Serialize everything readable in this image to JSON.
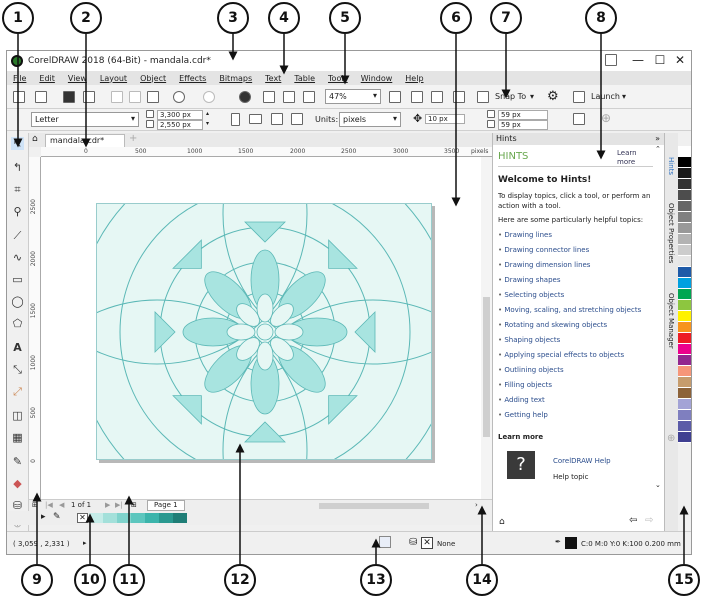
{
  "window": {
    "title": "CorelDRAW 2018 (64-Bit) - mandala.cdr*",
    "controls": [
      "—",
      "☐",
      "✕"
    ]
  },
  "menu": [
    "File",
    "Edit",
    "View",
    "Layout",
    "Object",
    "Effects",
    "Bitmaps",
    "Text",
    "Table",
    "Tools",
    "Window",
    "Help"
  ],
  "standard_toolbar": {
    "zoom": "47%",
    "snap_to": "Snap To",
    "launch": "Launch"
  },
  "property_bar": {
    "page_size": "Letter",
    "width": "3,300 px",
    "height": "2,550 px",
    "units_label": "Units:",
    "units": "pixels",
    "nudge": "10 px",
    "dup_x": "59 px",
    "dup_y": "59 px"
  },
  "document_tab": "mandala.cdr*",
  "rulers": {
    "horizontal": [
      "0",
      "500",
      "1000",
      "1500",
      "2000",
      "2500",
      "3000",
      "3500",
      "pixels"
    ],
    "vertical": [
      "2500",
      "2000",
      "1500",
      "1000",
      "500",
      "0"
    ]
  },
  "page_nav": {
    "counter": "1  of  1",
    "page_tab": "Page 1"
  },
  "status": {
    "coords": "( 3,059 , 2,331 )",
    "fill": "None",
    "outline": "C:0 M:0 Y:0 K:100  0.200 mm"
  },
  "hints": {
    "header": "Hints",
    "title": "HINTS",
    "learn_more_link": "Learn more",
    "welcome": "Welcome to Hints!",
    "intro": "To display topics, click a tool, or perform an action with a tool.",
    "helpful": "Here are some particularly helpful topics:",
    "topics": [
      "Drawing lines",
      "Drawing connector lines",
      "Drawing dimension lines",
      "Drawing shapes",
      "Selecting objects",
      "Moving, scaling, and stretching objects",
      "Rotating and skewing objects",
      "Shaping objects",
      "Applying special effects to objects",
      "Outlining objects",
      "Filling objects",
      "Adding text",
      "Getting help"
    ],
    "learn_more": "Learn more",
    "help_link": "CorelDRAW Help",
    "help_topic": "Help topic"
  },
  "side_tabs": [
    "Hints",
    "Object Properties",
    "Object Manager"
  ],
  "callouts": [
    "1",
    "2",
    "3",
    "4",
    "5",
    "6",
    "7",
    "8",
    "9",
    "10",
    "11",
    "12",
    "13",
    "14",
    "15"
  ],
  "palette_colors": [
    "#ffffff",
    "#000000",
    "#1a1a1a",
    "#333333",
    "#4d4d4d",
    "#666666",
    "#808080",
    "#999999",
    "#b3b3b3",
    "#cccccc",
    "#e6e6e6",
    "#1e5aa8",
    "#00a0e0",
    "#00a651",
    "#8dc63f",
    "#fff200",
    "#f7941d",
    "#ed1c24",
    "#ec008c",
    "#92278f",
    "#f69679",
    "#c69c6d",
    "#8c6239",
    "#a3a3d6",
    "#7f7fbf",
    "#5b5ba8",
    "#3f3f91"
  ],
  "doc_palette_colors": [
    "#c5ece8",
    "#a3e0da",
    "#7fd3cc",
    "#5cc6be",
    "#3bb4ab",
    "#2a9990",
    "#1f7e77"
  ],
  "mandala_colors": {
    "light": "#e6f7f4",
    "mid": "#a8e4e0",
    "line": "#5bb8b6"
  }
}
